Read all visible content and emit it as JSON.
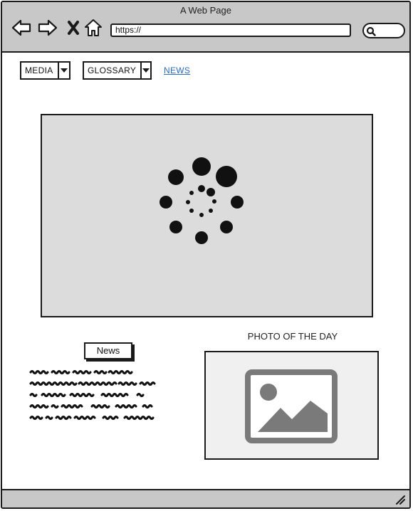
{
  "window": {
    "title": "A Web Page"
  },
  "browser": {
    "url": "https://",
    "nav_icons": [
      "back-arrow-icon",
      "forward-arrow-icon",
      "close-x-icon",
      "home-icon"
    ],
    "search_icon": "search-icon"
  },
  "menus": [
    {
      "label": "MEDIA",
      "icon": "dropdown-arrow-icon"
    },
    {
      "label": "GLOSSARY",
      "icon": "dropdown-arrow-icon"
    }
  ],
  "links": {
    "news": "NEWS"
  },
  "media": {
    "icon": "loading-spinner-icon",
    "background": "#dcdcdc"
  },
  "news_section": {
    "button_label": "News"
  },
  "photo_section": {
    "title": "PHOTO OF THE DAY",
    "icon": "image-placeholder-icon"
  },
  "colors": {
    "chrome": "#c8c8c8",
    "link": "#2a6bbf",
    "outline": "#1a1a1a"
  }
}
